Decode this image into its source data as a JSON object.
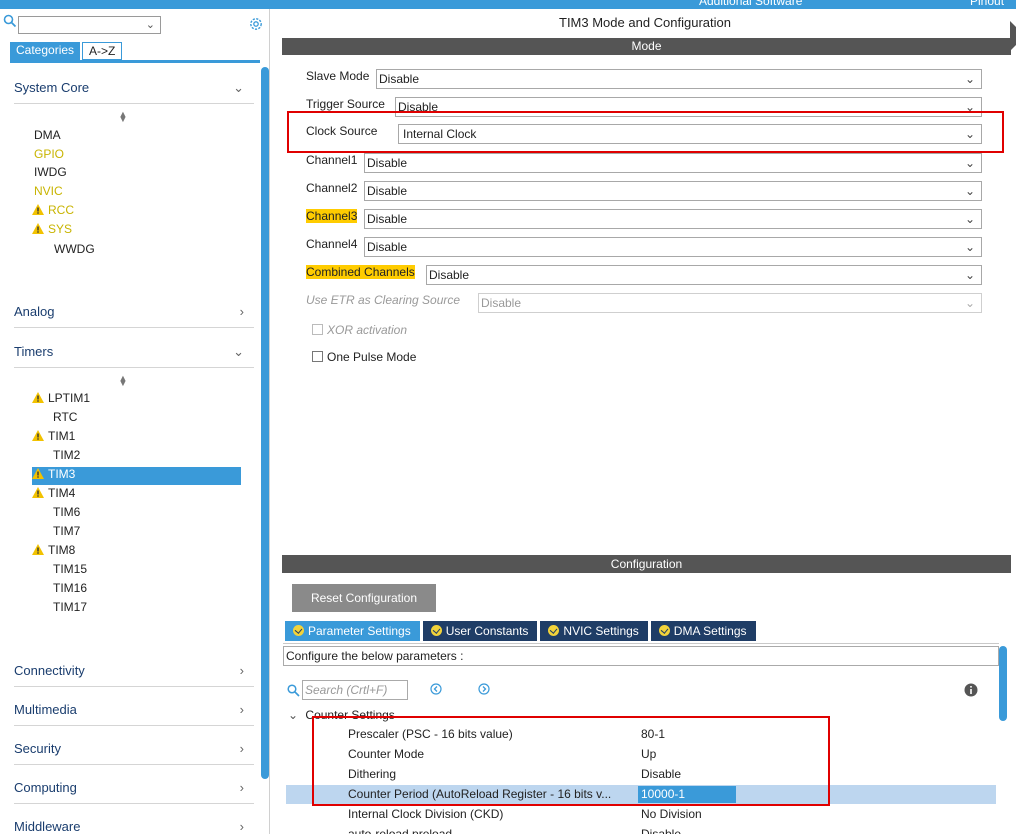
{
  "topbar": {
    "text_a": "Additional Software",
    "text_b": "Pinout"
  },
  "sidebar": {
    "tabs": [
      "Categories",
      "A->Z"
    ],
    "groups": {
      "system_core": {
        "label": "System Core",
        "items": [
          "DMA",
          "GPIO",
          "IWDG",
          "NVIC",
          "RCC",
          "SYS",
          "WWDG"
        ]
      },
      "analog": {
        "label": "Analog"
      },
      "timers": {
        "label": "Timers",
        "items": [
          "LPTIM1",
          "RTC",
          "TIM1",
          "TIM2",
          "TIM3",
          "TIM4",
          "TIM6",
          "TIM7",
          "TIM8",
          "TIM15",
          "TIM16",
          "TIM17"
        ]
      },
      "connectivity": {
        "label": "Connectivity"
      },
      "multimedia": {
        "label": "Multimedia"
      },
      "security": {
        "label": "Security"
      },
      "computing": {
        "label": "Computing"
      },
      "middleware": {
        "label": "Middleware"
      }
    }
  },
  "main": {
    "title": "TIM3 Mode and Configuration",
    "mode_header": "Mode",
    "fields": {
      "slave_mode": {
        "label": "Slave Mode",
        "value": "Disable"
      },
      "trigger_source": {
        "label": "Trigger Source",
        "value": "Disable"
      },
      "clock_source": {
        "label": "Clock Source",
        "value": "Internal Clock"
      },
      "channel1": {
        "label": "Channel1",
        "value": "Disable"
      },
      "channel2": {
        "label": "Channel2",
        "value": "Disable"
      },
      "channel3": {
        "label": "Channel3",
        "value": "Disable"
      },
      "channel4": {
        "label": "Channel4",
        "value": "Disable"
      },
      "combined": {
        "label": "Combined Channels",
        "value": "Disable"
      },
      "etr": {
        "label": "Use ETR as Clearing Source",
        "value": "Disable"
      }
    },
    "xor_label": "XOR activation",
    "one_pulse_label": "One Pulse Mode",
    "config_header": "Configuration",
    "reset_label": "Reset Configuration",
    "tabs": [
      "Parameter Settings",
      "User Constants",
      "NVIC Settings",
      "DMA Settings"
    ],
    "configure_text": "Configure the below parameters :",
    "search_placeholder": "Search (Crtl+F)",
    "tree_group": "Counter Settings",
    "params": [
      {
        "name": "Prescaler (PSC - 16 bits value)",
        "value": "80-1"
      },
      {
        "name": "Counter Mode",
        "value": "Up"
      },
      {
        "name": "Dithering",
        "value": "Disable"
      },
      {
        "name": "Counter Period (AutoReload Register - 16 bits v...",
        "value": "10000-1"
      },
      {
        "name": "Internal Clock Division (CKD)",
        "value": "No Division"
      },
      {
        "name": "auto-reload preload",
        "value": "Disable"
      }
    ]
  },
  "colors": {
    "accent": "#3a9ad9",
    "header_dark": "#555555",
    "tab_dark": "#1f3d66",
    "highlight": "#ffcc00",
    "warning": "#f2c200",
    "annotation_red": "#e00000"
  }
}
